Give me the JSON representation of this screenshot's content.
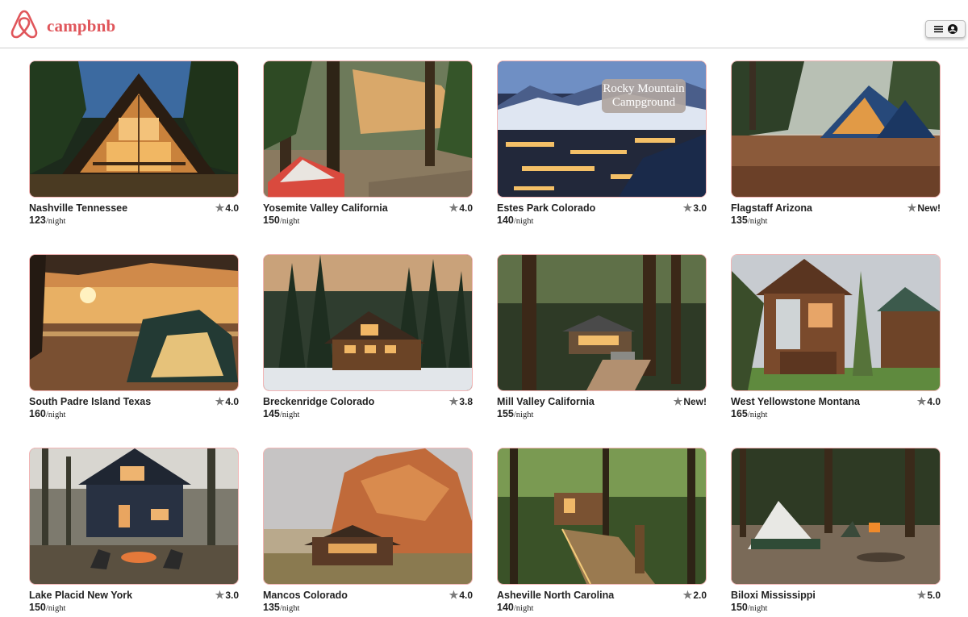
{
  "header": {
    "brand": "campbnb",
    "brand_color": "#e0565b",
    "logo_icon": "airbnb-logo-icon",
    "menu_icons": [
      "hamburger-icon",
      "user-icon"
    ]
  },
  "price_unit": "/night",
  "listings": [
    {
      "title": "Nashville Tennessee",
      "rating": "4.0",
      "price": "123",
      "scene": "a-frame cabin at dusk"
    },
    {
      "title": "Yosemite Valley California",
      "rating": "4.0",
      "price": "150",
      "scene": "tent in pine forest"
    },
    {
      "title": "Estes Park Colorado",
      "rating": "3.0",
      "price": "140",
      "scene": "mountain town at night",
      "badge": "Rocky Mountain Campground"
    },
    {
      "title": "Flagstaff Arizona",
      "rating": "New!",
      "price": "135",
      "scene": "lit tent in forest"
    },
    {
      "title": "South Padre Island Texas",
      "rating": "4.0",
      "price": "160",
      "scene": "tent on beach at sunset"
    },
    {
      "title": "Breckenridge Colorado",
      "rating": "3.8",
      "price": "145",
      "scene": "log cabin in snowy forest"
    },
    {
      "title": "Mill Valley California",
      "rating": "New!",
      "price": "155",
      "scene": "cabin among redwoods"
    },
    {
      "title": "West Yellowstone Montana",
      "rating": "4.0",
      "price": "165",
      "scene": "wooden cabins with porch"
    },
    {
      "title": "Lake Placid New York",
      "rating": "3.0",
      "price": "150",
      "scene": "dark cabin with fire pit"
    },
    {
      "title": "Mancos Colorado",
      "rating": "4.0",
      "price": "135",
      "scene": "cabin under red rock"
    },
    {
      "title": "Asheville North Carolina",
      "rating": "2.0",
      "price": "140",
      "scene": "treehouse with bridge"
    },
    {
      "title": "Biloxi Mississippi",
      "rating": "5.0",
      "price": "150",
      "scene": "dome tent in campsite"
    }
  ]
}
